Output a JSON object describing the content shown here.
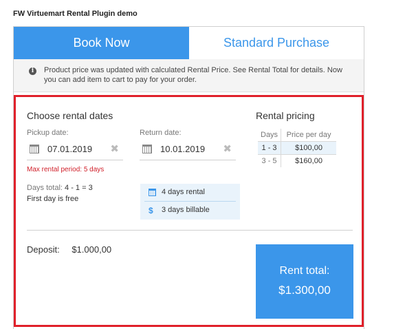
{
  "page": {
    "title": "FW Virtuemart Rental Plugin demo"
  },
  "tabs": [
    {
      "label": "Book Now",
      "active": true
    },
    {
      "label": "Standard Purchase",
      "active": false
    }
  ],
  "notice": {
    "icon": "info-icon",
    "text": "Product price was updated with calculated Rental Price. See Rental Total for details. Now you can add item to cart to pay for your order."
  },
  "rental_dates": {
    "title": "Choose rental dates",
    "pickup": {
      "label": "Pickup date:",
      "value": "07.01.2019",
      "icon": "calendar-icon",
      "clear_icon": "close-icon"
    },
    "return": {
      "label": "Return date:",
      "value": "10.01.2019",
      "icon": "calendar-icon",
      "clear_icon": "close-icon"
    },
    "max_period": "Max rental period: 5 days",
    "days_total_label": "Days total:",
    "days_total_value": "4 - 1 = 3",
    "first_day_note": "First day is free",
    "summary": {
      "rental_days": "4 days rental",
      "billable_days": "3 days billable"
    }
  },
  "pricing": {
    "title": "Rental pricing",
    "headers": [
      "Days",
      "Price per day"
    ],
    "rows": [
      {
        "days": "1 - 3",
        "price": "$100,00",
        "highlighted": true
      },
      {
        "days": "3 - 5",
        "price": "$160,00",
        "highlighted": false
      }
    ]
  },
  "deposit": {
    "label": "Deposit:",
    "value": "$1.000,00"
  },
  "rent_total": {
    "label": "Rent total:",
    "value": "$1.300,00"
  },
  "colors": {
    "accent": "#3b96ea",
    "highlight_border": "#e0202a",
    "warning": "#d0202a",
    "summary_bg": "#e9f3fb"
  }
}
